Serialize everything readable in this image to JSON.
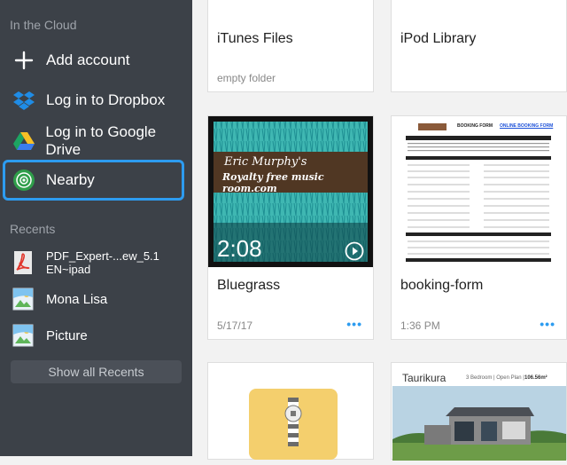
{
  "sidebar": {
    "cloud_label": "In the Cloud",
    "items": [
      {
        "label": "Add account",
        "icon": "plus-icon"
      },
      {
        "label": "Log in to Dropbox",
        "icon": "dropbox-icon"
      },
      {
        "label": "Log in to Google Drive",
        "icon": "google-drive-icon"
      },
      {
        "label": "Nearby",
        "icon": "nearby-radar-icon",
        "selected": true
      }
    ],
    "recents_label": "Recents",
    "recents": [
      {
        "label": "PDF_Expert-...ew_5.1 EN~ipad",
        "icon": "pdf-icon"
      },
      {
        "label": "Mona Lisa",
        "icon": "image-icon"
      },
      {
        "label": "Picture",
        "icon": "image-icon"
      }
    ],
    "show_all_label": "Show all Recents"
  },
  "files": [
    {
      "name": "iTunes Files",
      "sub": "empty folder"
    },
    {
      "name": "iPod Library",
      "sub": ""
    },
    {
      "name": "Bluegrass",
      "sub": "5/17/17",
      "duration": "2:08",
      "thumb_title": "Eric Murphy's",
      "thumb_subtitle": "Royalty free music room.com"
    },
    {
      "name": "booking-form",
      "sub": "1:36 PM",
      "thumb_header": "BOOKING FORM",
      "thumb_link": "ONLINE BOOKING FORM"
    },
    {
      "name": "",
      "sub": "",
      "icon": "zip-archive-icon"
    },
    {
      "name": "",
      "sub": "",
      "thumb_brand": "Taurikura",
      "thumb_spec": "3 Bedroom | Open Plan |",
      "thumb_area": "106.56m²"
    }
  ],
  "colors": {
    "sidebar_bg": "#3c4148",
    "accent": "#2d9cf0"
  }
}
